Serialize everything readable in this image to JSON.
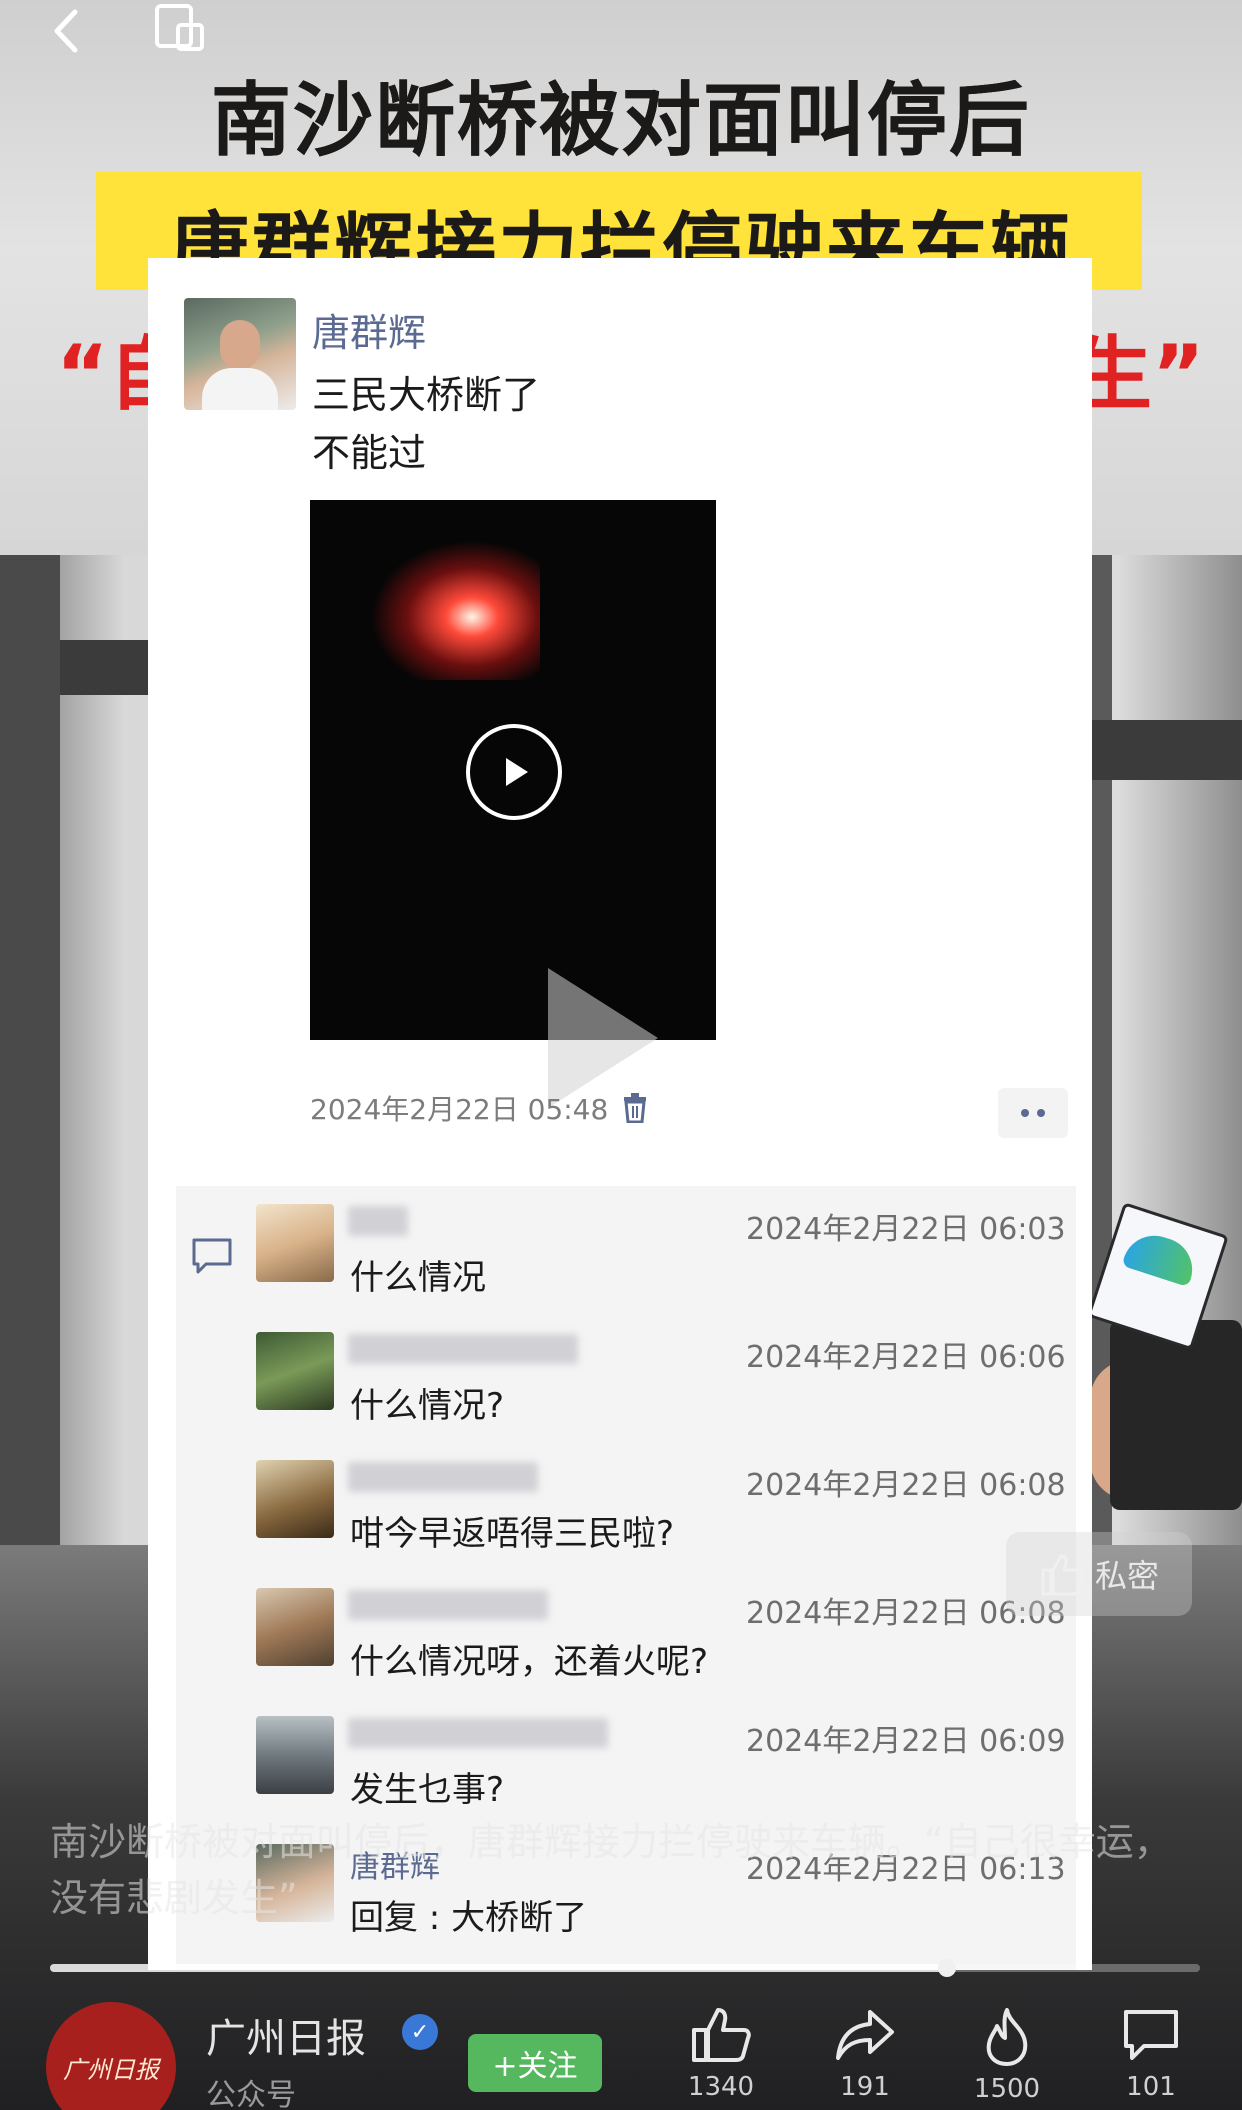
{
  "headline": {
    "line1": "南沙断桥被对面叫停后",
    "line2": "唐群辉接力拦停驶来车辆",
    "line3_left": "“自",
    "line3_right": "生”"
  },
  "post": {
    "author": "唐群辉",
    "text": "三民大桥断了\n不能过",
    "timestamp": "2024年2月22日 05:48"
  },
  "comments": [
    {
      "name": "",
      "time": "2024年2月22日 06:03",
      "text": "什么情况"
    },
    {
      "name": "",
      "time": "2024年2月22日 06:06",
      "text": "什么情况?"
    },
    {
      "name": "",
      "time": "2024年2月22日 06:08",
      "text": "咁今早返唔得三民啦?"
    },
    {
      "name": "",
      "time": "2024年2月22日 06:08",
      "text": "什么情况呀，还着火呢?"
    },
    {
      "name": "",
      "time": "2024年2月22日 06:09",
      "text": "发生乜事?"
    },
    {
      "name": "唐群辉",
      "time": "2024年2月22日 06:13",
      "text": "回复 : 大桥断了"
    }
  ],
  "private_label": "私密",
  "caption": "南沙断桥被对面叫停后，唐群辉接力拦停驶来车辆。“自己很幸运，没有悲剧发生”",
  "progress": 0.78,
  "account": {
    "logo_text": "广州日报",
    "name": "广州日报",
    "subtitle": "公众号",
    "follow_label": "+关注"
  },
  "actions": [
    {
      "icon": "like-icon",
      "count": "1340"
    },
    {
      "icon": "share-icon",
      "count": "191"
    },
    {
      "icon": "fire-icon",
      "count": "1500"
    },
    {
      "icon": "comment-icon",
      "count": "101"
    }
  ],
  "colors": {
    "headline_band": "#ffe23a",
    "headline_red": "#e02222",
    "link_name": "#5b6a91",
    "follow_green": "#55b85f"
  }
}
